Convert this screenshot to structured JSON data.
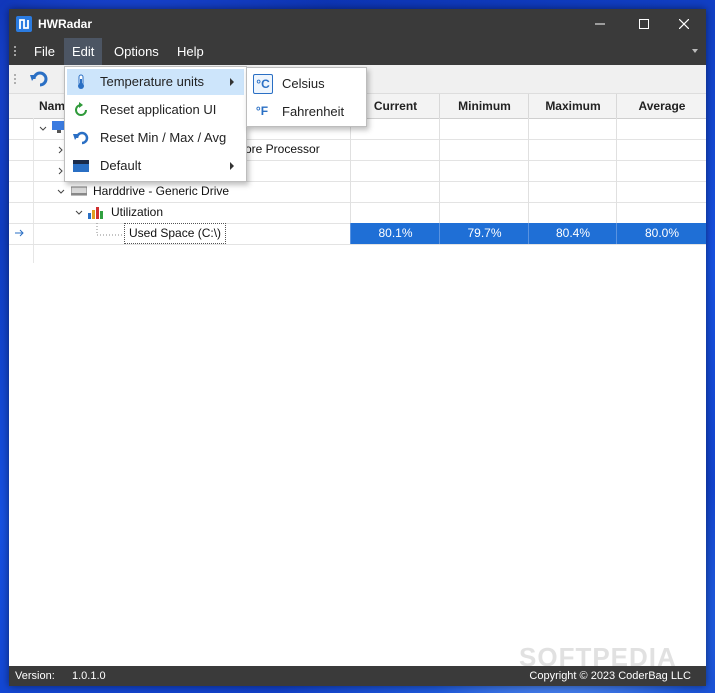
{
  "window": {
    "title": "HWRadar"
  },
  "menubar": {
    "items": [
      "File",
      "Edit",
      "Options",
      "Help"
    ]
  },
  "grid": {
    "columns": [
      "Name",
      "Current",
      "Minimum",
      "Maximum",
      "Average"
    ],
    "rows": [
      {
        "name": "",
        "level": 1
      },
      {
        "name": "ore Processor",
        "level": 2
      },
      {
        "name": "",
        "level": 2
      },
      {
        "name": "Harddrive - Generic Drive",
        "level": 1
      },
      {
        "name": "Utilization",
        "level": 2
      },
      {
        "name": "Used Space (C:\\)",
        "level": 3,
        "current": "80.1%",
        "minimum": "79.7%",
        "maximum": "80.4%",
        "average": "80.0%"
      }
    ]
  },
  "edit_menu": {
    "items": [
      {
        "label": "Temperature units",
        "icon": "thermometer-icon",
        "submenu": true
      },
      {
        "label": "Reset application UI",
        "icon": "refresh-icon"
      },
      {
        "label": "Reset Min / Max / Avg",
        "icon": "undo-icon"
      },
      {
        "label": "Default",
        "icon": "theme-icon",
        "submenu": true
      }
    ]
  },
  "temperature_submenu": {
    "items": [
      {
        "label": "Celsius",
        "glyph": "°C",
        "checked": true
      },
      {
        "label": "Fahrenheit",
        "glyph": "°F",
        "checked": false
      }
    ]
  },
  "statusbar": {
    "version_label": "Version:",
    "version": "1.0.1.0",
    "copyright": "Copyright © 2023 CoderBag LLC"
  },
  "watermark": "SOFTPEDIA",
  "colors": {
    "titlebar": "#3a3a3a",
    "selection": "#1f6fd6",
    "menu_highlight": "#cde5fb",
    "accent_icon": "#2a6fc4"
  }
}
